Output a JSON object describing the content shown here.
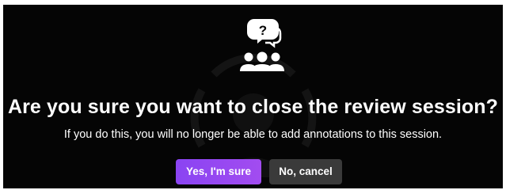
{
  "dialog": {
    "icon": "people-question-icon",
    "title": "Are you sure you want to close the review session?",
    "message": "If you do this, you will no longer be able to add annotations to this session.",
    "confirm_label": "Yes, I'm sure",
    "cancel_label": "No, cancel"
  },
  "colors": {
    "background": "#050505",
    "text": "#ffffff",
    "confirm_button": "#9447f1",
    "cancel_button": "#3a3a3a"
  }
}
